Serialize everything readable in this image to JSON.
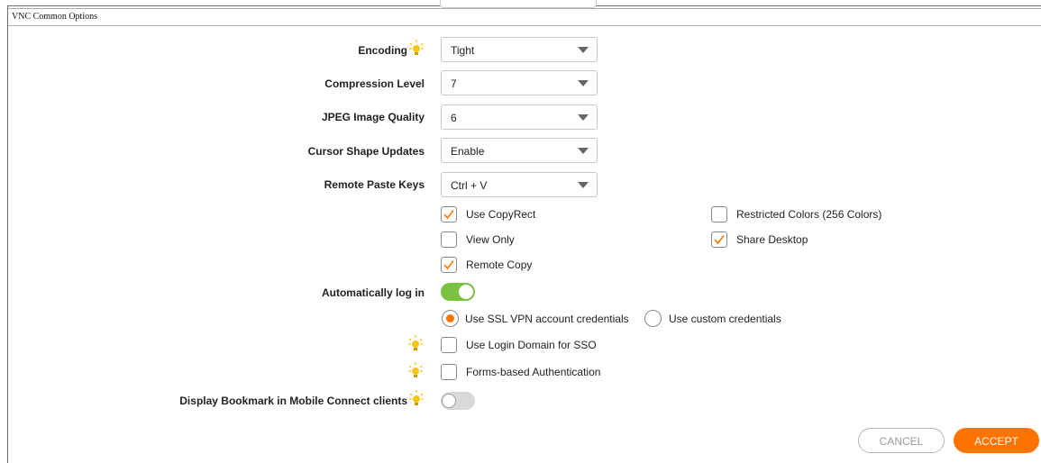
{
  "section": {
    "title": "VNC Common Options"
  },
  "fields": {
    "encoding": {
      "label": "Encoding",
      "value": "Tight"
    },
    "compression": {
      "label": "Compression Level",
      "value": "7"
    },
    "jpeg": {
      "label": "JPEG Image Quality",
      "value": "6"
    },
    "cursor": {
      "label": "Cursor Shape Updates",
      "value": "Enable"
    },
    "paste": {
      "label": "Remote Paste Keys",
      "value": "Ctrl + V"
    }
  },
  "checkboxes": {
    "copyrect": {
      "label": "Use CopyRect",
      "checked": true
    },
    "restricted": {
      "label": "Restricted Colors (256 Colors)",
      "checked": false
    },
    "viewonly": {
      "label": "View Only",
      "checked": false
    },
    "share": {
      "label": "Share Desktop",
      "checked": true
    },
    "remotecopy": {
      "label": "Remote Copy",
      "checked": true
    },
    "logindomain": {
      "label": "Use Login Domain for SSO",
      "checked": false
    },
    "forms": {
      "label": "Forms-based Authentication",
      "checked": false
    }
  },
  "autologin": {
    "label": "Automatically log in",
    "enabled": true,
    "option_ssl": "Use SSL VPN account credentials",
    "option_custom": "Use custom credentials",
    "selected": "ssl"
  },
  "mobile": {
    "label": "Display Bookmark in Mobile Connect clients",
    "enabled": false
  },
  "buttons": {
    "cancel": "CANCEL",
    "accept": "ACCEPT"
  },
  "colors": {
    "accent": "#ff7300",
    "toggle_on": "#7ac142",
    "toggle_off": "#d9d9d9",
    "bulb": "#f5c518"
  },
  "icons": {
    "tip": "lightbulb-icon",
    "check": "checkmark-icon",
    "arrow": "dropdown-arrow-icon"
  }
}
